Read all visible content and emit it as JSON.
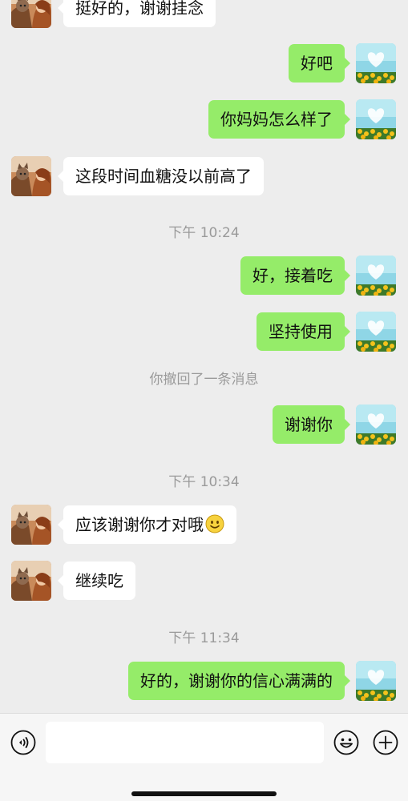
{
  "messages": {
    "partial_in": "挺好的，谢谢挂念",
    "m1": "好吧",
    "m2": "你妈妈怎么样了",
    "m3": "这段时间血糖没以前高了",
    "t1": "下午 10:24",
    "m4": "好，接着吃",
    "m5": "坚持使用",
    "recall": "你撤回了一条消息",
    "m6": "谢谢你",
    "t2": "下午 10:34",
    "m7": "应该谢谢你才对哦",
    "m8": "继续吃",
    "t3": "下午 11:34",
    "m9": "好的，谢谢你的信心满满的"
  },
  "input_bar": {
    "voice_icon": "voice-icon",
    "emoji_icon": "emoji-icon",
    "plus_icon": "plus-icon"
  },
  "colors": {
    "background": "#ededed",
    "outgoing_bubble": "#95ec69",
    "incoming_bubble": "#ffffff",
    "timestamp_text": "#9a9a9a"
  }
}
